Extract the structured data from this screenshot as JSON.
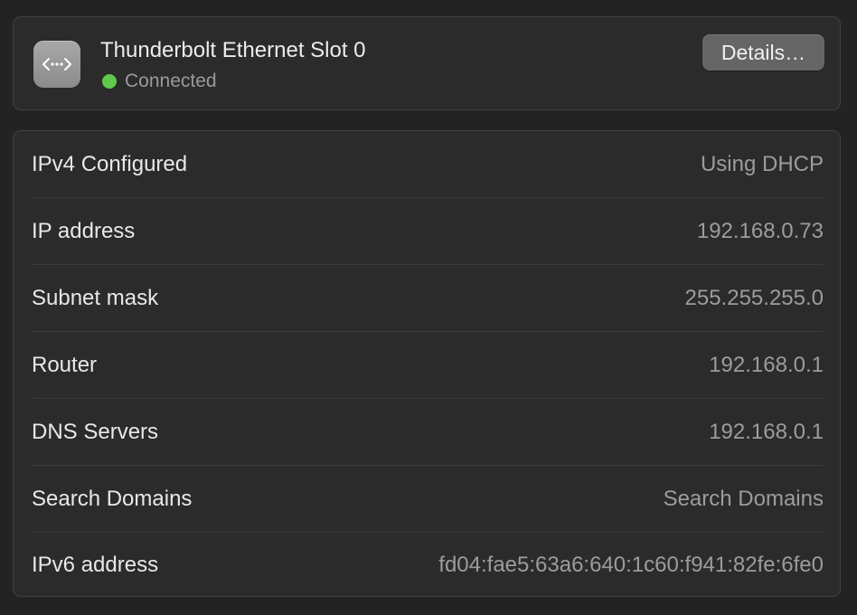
{
  "header": {
    "title": "Thunderbolt Ethernet Slot 0",
    "status": "Connected",
    "status_color": "#5fc94c",
    "icon": "ethernet-arrows-icon",
    "details_label": "Details…"
  },
  "rows": [
    {
      "label": "IPv4 Configured",
      "value": "Using DHCP"
    },
    {
      "label": "IP address",
      "value": "192.168.0.73"
    },
    {
      "label": "Subnet mask",
      "value": "255.255.255.0"
    },
    {
      "label": "Router",
      "value": "192.168.0.1"
    },
    {
      "label": "DNS Servers",
      "value": "192.168.0.1"
    },
    {
      "label": "Search Domains",
      "value": "Search Domains"
    },
    {
      "label": "IPv6 address",
      "value": "fd04:fae5:63a6:640:1c60:f941:82fe:6fe0"
    }
  ]
}
